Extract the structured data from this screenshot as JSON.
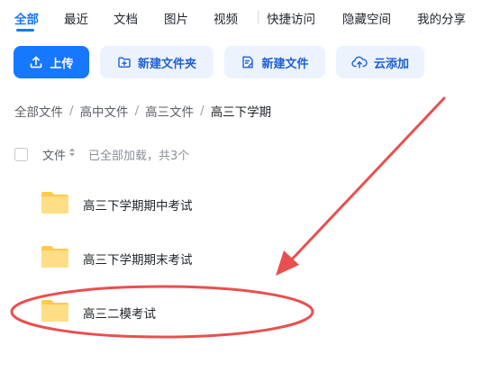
{
  "tabs": [
    {
      "label": "全部",
      "active": true
    },
    {
      "label": "最近",
      "active": false
    },
    {
      "label": "文档",
      "active": false
    },
    {
      "label": "图片",
      "active": false
    },
    {
      "label": "视频",
      "active": false
    },
    {
      "label": "快捷访问",
      "active": false
    },
    {
      "label": "隐藏空间",
      "active": false
    },
    {
      "label": "我的分享",
      "active": false
    }
  ],
  "toolbar": {
    "upload_label": "上传",
    "new_folder_label": "新建文件夹",
    "new_file_label": "新建文件",
    "cloud_add_label": "云添加"
  },
  "breadcrumb": [
    "全部文件",
    "高中文件",
    "高三文件",
    "高三下学期"
  ],
  "breadcrumb_separator": "/",
  "list_header": {
    "name_column": "文件",
    "status": "已全部加载，共3个"
  },
  "folders": [
    {
      "name": "高三下学期期中考试"
    },
    {
      "name": "高三下学期期末考试"
    },
    {
      "name": "高三二模考试"
    }
  ],
  "colors": {
    "accent": "#1677ff",
    "button_light_bg": "#edf3fe",
    "folder": "#ffc94a",
    "annotation": "#e8504f"
  },
  "icons": {
    "upload": "upload-icon",
    "new_folder": "folder-plus-icon",
    "new_file": "file-edit-icon",
    "cloud_add": "cloud-upload-icon",
    "folder": "folder-icon",
    "sort": "sort-icon"
  }
}
